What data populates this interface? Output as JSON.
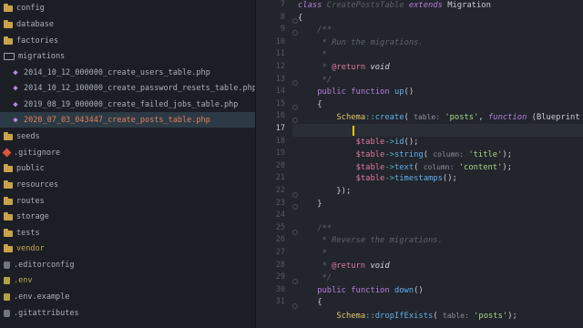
{
  "sidebar": {
    "items": [
      {
        "label": "config",
        "icon": "folder-icon",
        "style": "dim"
      },
      {
        "label": "database",
        "icon": "folder-icon",
        "style": "dim"
      },
      {
        "label": "factories",
        "icon": "folder-icon",
        "style": "dim"
      },
      {
        "label": "migrations",
        "icon": "folder-open-icon",
        "style": "dim"
      },
      {
        "label": "2014_10_12_000000_create_users_table.php",
        "icon": "php-icon",
        "style": "dim"
      },
      {
        "label": "2014_10_12_100000_create_password_resets_table.php",
        "icon": "php-icon",
        "style": "dim"
      },
      {
        "label": "2019_08_19_000000_create_failed_jobs_table.php",
        "icon": "php-icon",
        "style": "dim"
      },
      {
        "label": "2020_07_03_043447_create_posts_table.php",
        "icon": "php-icon",
        "style": "red"
      },
      {
        "label": "seeds",
        "icon": "folder-icon",
        "style": "dim"
      },
      {
        "label": ".gitignore",
        "icon": "git-icon",
        "style": "dim"
      },
      {
        "label": "public",
        "icon": "folder-icon",
        "style": "dim"
      },
      {
        "label": "resources",
        "icon": "folder-icon",
        "style": "dim"
      },
      {
        "label": "routes",
        "icon": "folder-icon",
        "style": "dim"
      },
      {
        "label": "storage",
        "icon": "folder-icon",
        "style": "dim"
      },
      {
        "label": "tests",
        "icon": "folder-icon",
        "style": "dim"
      },
      {
        "label": "vendor",
        "icon": "folder-icon",
        "style": "yellow"
      },
      {
        "label": ".editorconfig",
        "icon": "file-icon",
        "style": "dim"
      },
      {
        "label": ".env",
        "icon": "env-icon",
        "style": "yellow"
      },
      {
        "label": ".env.example",
        "icon": "env-icon",
        "style": "dim"
      },
      {
        "label": ".gitattributes",
        "icon": "file-icon",
        "style": "dim"
      }
    ]
  },
  "editor": {
    "line_numbers": [
      "7",
      "8",
      "9",
      "10",
      "11",
      "12",
      "13",
      "14",
      "15",
      "16",
      "17",
      "18",
      "19",
      "20",
      "21",
      "22",
      "23",
      "24",
      "25",
      "26",
      "27",
      "28",
      "29",
      "30",
      "31"
    ],
    "active_line": "17",
    "code": {
      "l7_class": "class",
      "l7_name": "CreatePostsTable",
      "l7_extends": "extends",
      "l7_parent": "Migration",
      "l8": "{",
      "l9": "/**",
      "l10": " * Run the migrations.",
      "l11": " *",
      "l12_star": " * ",
      "l12_ann": "@return",
      "l12_type": "void",
      "l13": " */",
      "l14_public": "public",
      "l14_function": "function",
      "l14_name": "up",
      "l14_parens": "()",
      "l15": "{",
      "l16_schema": "Schema",
      "l16_op": "::",
      "l16_create": "create",
      "l16_open": "(",
      "l16_hint": "table:",
      "l16_str": "'posts'",
      "l16_comma": ",",
      "l16_function": "function",
      "l16_rest": "(Blueprint $table)",
      "l18_var": "$table",
      "l18_arrow": "->",
      "l18_fn": "id",
      "l18_end": "();",
      "l19_var": "$table",
      "l19_arrow": "->",
      "l19_fn": "string",
      "l19_open": "(",
      "l19_hint": "column:",
      "l19_str": "'title'",
      "l19_end": ");",
      "l20_var": "$table",
      "l20_arrow": "->",
      "l20_fn": "text",
      "l20_open": "(",
      "l20_hint": "column:",
      "l20_str": "'content'",
      "l20_end": ");",
      "l21_var": "$table",
      "l21_arrow": "->",
      "l21_fn": "timestamps",
      "l21_end": "();",
      "l22": "});",
      "l23": "}",
      "l25": "/**",
      "l26": " * Reverse the migrations.",
      "l27": " *",
      "l28_star": " * ",
      "l28_ann": "@return",
      "l28_type": "void",
      "l29": " */",
      "l30_public": "public",
      "l30_function": "function",
      "l30_name": "down",
      "l30_parens": "()",
      "l31": "{",
      "l32_schema": "Schema",
      "l32_op": "::",
      "l32_fn": "dropIfExists",
      "l32_open": "(",
      "l32_hint": "table:",
      "l32_str": "'posts'",
      "l32_end": ");"
    }
  },
  "colors": {
    "background": "#22252b",
    "sidebar": "#1b1e24",
    "keyword": "#b97ce0",
    "string": "#a8d68a",
    "variable": "#e07aa0",
    "function": "#61afef",
    "caret": "#f0c419"
  }
}
